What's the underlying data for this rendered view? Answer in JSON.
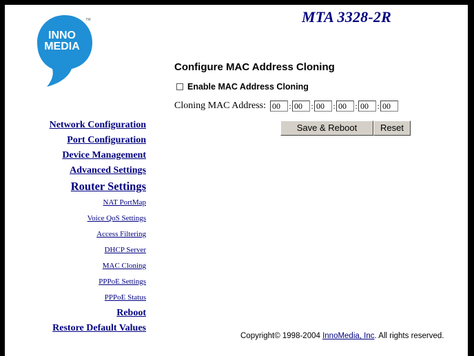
{
  "header": {
    "model": "MTA 3328-2R"
  },
  "logo": {
    "line1": "INNO",
    "line2": "MEDIA",
    "tm": "TM",
    "color": "#1f8fd6"
  },
  "nav": {
    "main_top": [
      {
        "label": "Network Configuration"
      },
      {
        "label": "Port Configuration"
      },
      {
        "label": "Device Management"
      },
      {
        "label": "Advanced Settings"
      }
    ],
    "active": {
      "label": "Router Settings"
    },
    "sub": [
      {
        "label": "NAT PortMap"
      },
      {
        "label": "Voice QoS Settings"
      },
      {
        "label": "Access Filtering"
      },
      {
        "label": "DHCP Server"
      },
      {
        "label": "MAC Cloning"
      },
      {
        "label": "PPPoE Settings"
      },
      {
        "label": "PPPoE Status"
      }
    ],
    "main_bottom": [
      {
        "label": "Reboot"
      },
      {
        "label": "Restore Default Values"
      }
    ]
  },
  "form": {
    "heading": "Configure MAC Address Cloning",
    "enable_label": "Enable MAC Address Cloning",
    "enable_checked": false,
    "mac_label": "Cloning MAC Address:",
    "octets": [
      "00",
      "00",
      "00",
      "00",
      "00",
      "00"
    ],
    "separator": ":",
    "save_label": "Save & Reboot",
    "reset_label": "Reset"
  },
  "footer": {
    "prefix": "Copyright© 1998-2004 ",
    "link": "InnoMedia, Inc",
    "suffix": ". All rights reserved."
  },
  "colors": {
    "nav_link": "#000080",
    "title": "#000080",
    "button_face": "#d4d0c8"
  }
}
